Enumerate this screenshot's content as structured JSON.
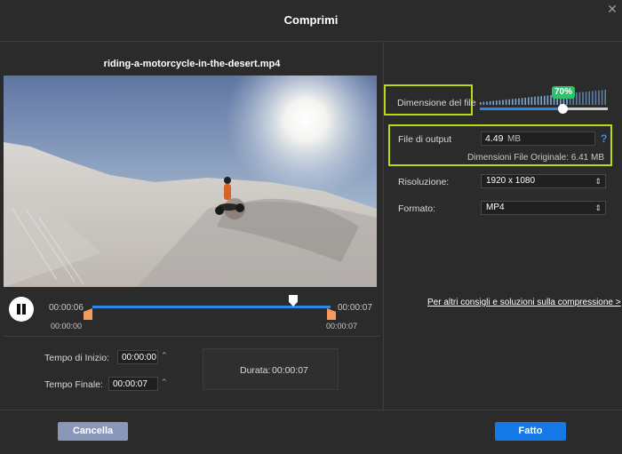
{
  "window": {
    "title": "Comprimi",
    "close_icon": "close-icon"
  },
  "video": {
    "filename": "riding-a-motorcycle-in-the-desert.mp4",
    "play_state_icon": "pause-icon"
  },
  "timeline": {
    "start_top": "00:00:06",
    "end_top": "00:00:07",
    "start_bottom": "00:00:00",
    "end_bottom": "00:00:07",
    "playhead_position": 0.84
  },
  "trim": {
    "start_label": "Tempo di Inizio:",
    "start_value": "00:00:00",
    "end_label": "Tempo Finale:",
    "end_value": "00:00:07",
    "duration_label": "Durata:",
    "duration_value": "00:00:07"
  },
  "settings": {
    "size_label": "Dimensione del file",
    "size_percent": "70%",
    "size_fraction": 0.7,
    "output_label": "File di output",
    "output_value": "4.49",
    "output_unit": "MB",
    "help_icon": "?",
    "original_size": "Dimensioni File Originale: 6.41 MB",
    "resolution_label": "Risoluzione:",
    "resolution_value": "1920 x 1080",
    "format_label": "Formato:",
    "format_value": "MP4",
    "tips_link": "Per altri consigli e soluzioni sulla compressione >"
  },
  "footer": {
    "cancel_label": "Cancella",
    "done_label": "Fatto"
  },
  "colors": {
    "accent": "#1479e6",
    "highlight": "#b4dc14",
    "badge": "#2fbf6d",
    "trim_handle": "#f39a5c"
  }
}
